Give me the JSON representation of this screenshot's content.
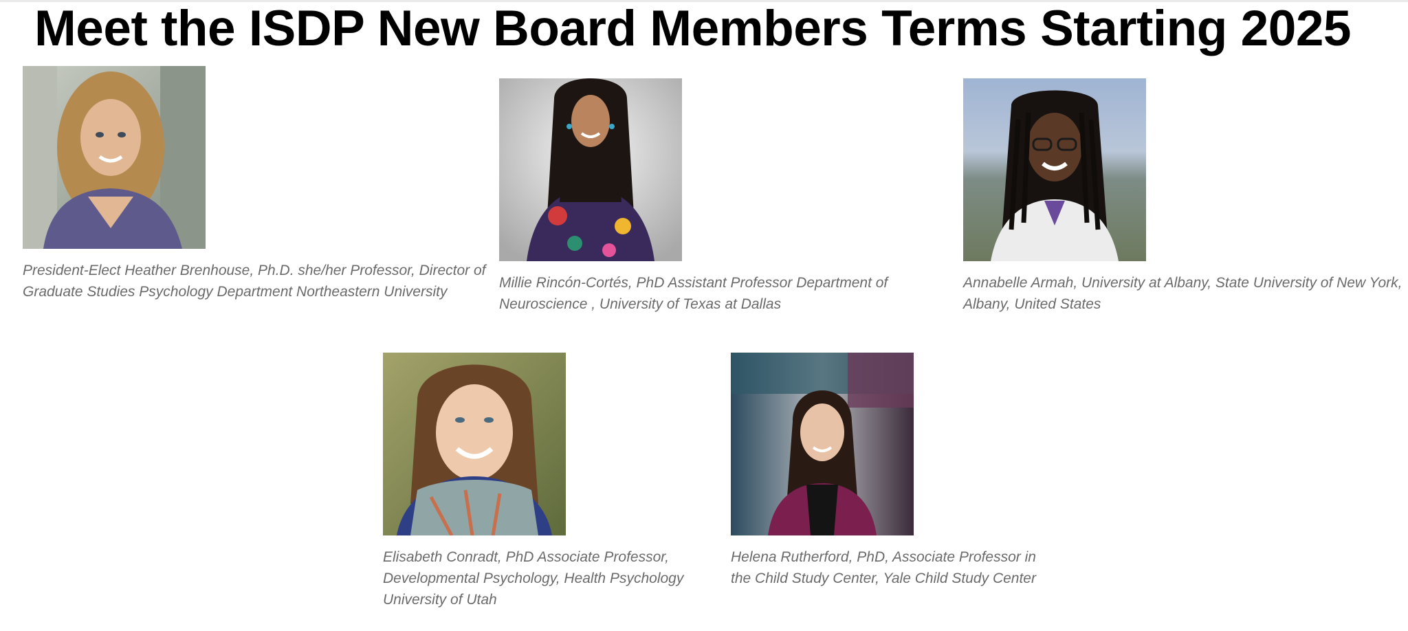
{
  "page": {
    "title": "Meet the ISDP New Board Members Terms Starting 2025"
  },
  "members": [
    {
      "caption": "President-Elect Heather Brenhouse, Ph.D. she/her Professor, Director of Graduate Studies Psychology Department Northeastern University"
    },
    {
      "caption": "Millie Rincón-Cortés, PhD Assistant Professor Department of Neuroscience , University of Texas at Dallas"
    },
    {
      "caption": "Annabelle Armah, University at Albany, State University of New York, Albany, United States"
    },
    {
      "caption": "Elisabeth Conradt, PhD Associate Professor, Developmental Psychology, Health Psychology University of Utah"
    },
    {
      "caption": "Helena Rutherford, PhD, Associate Professor in the Child Study Center, Yale Child Study Center"
    }
  ],
  "colors": {
    "title": "#000000",
    "caption": "#6a6a6a",
    "background": "#ffffff"
  }
}
